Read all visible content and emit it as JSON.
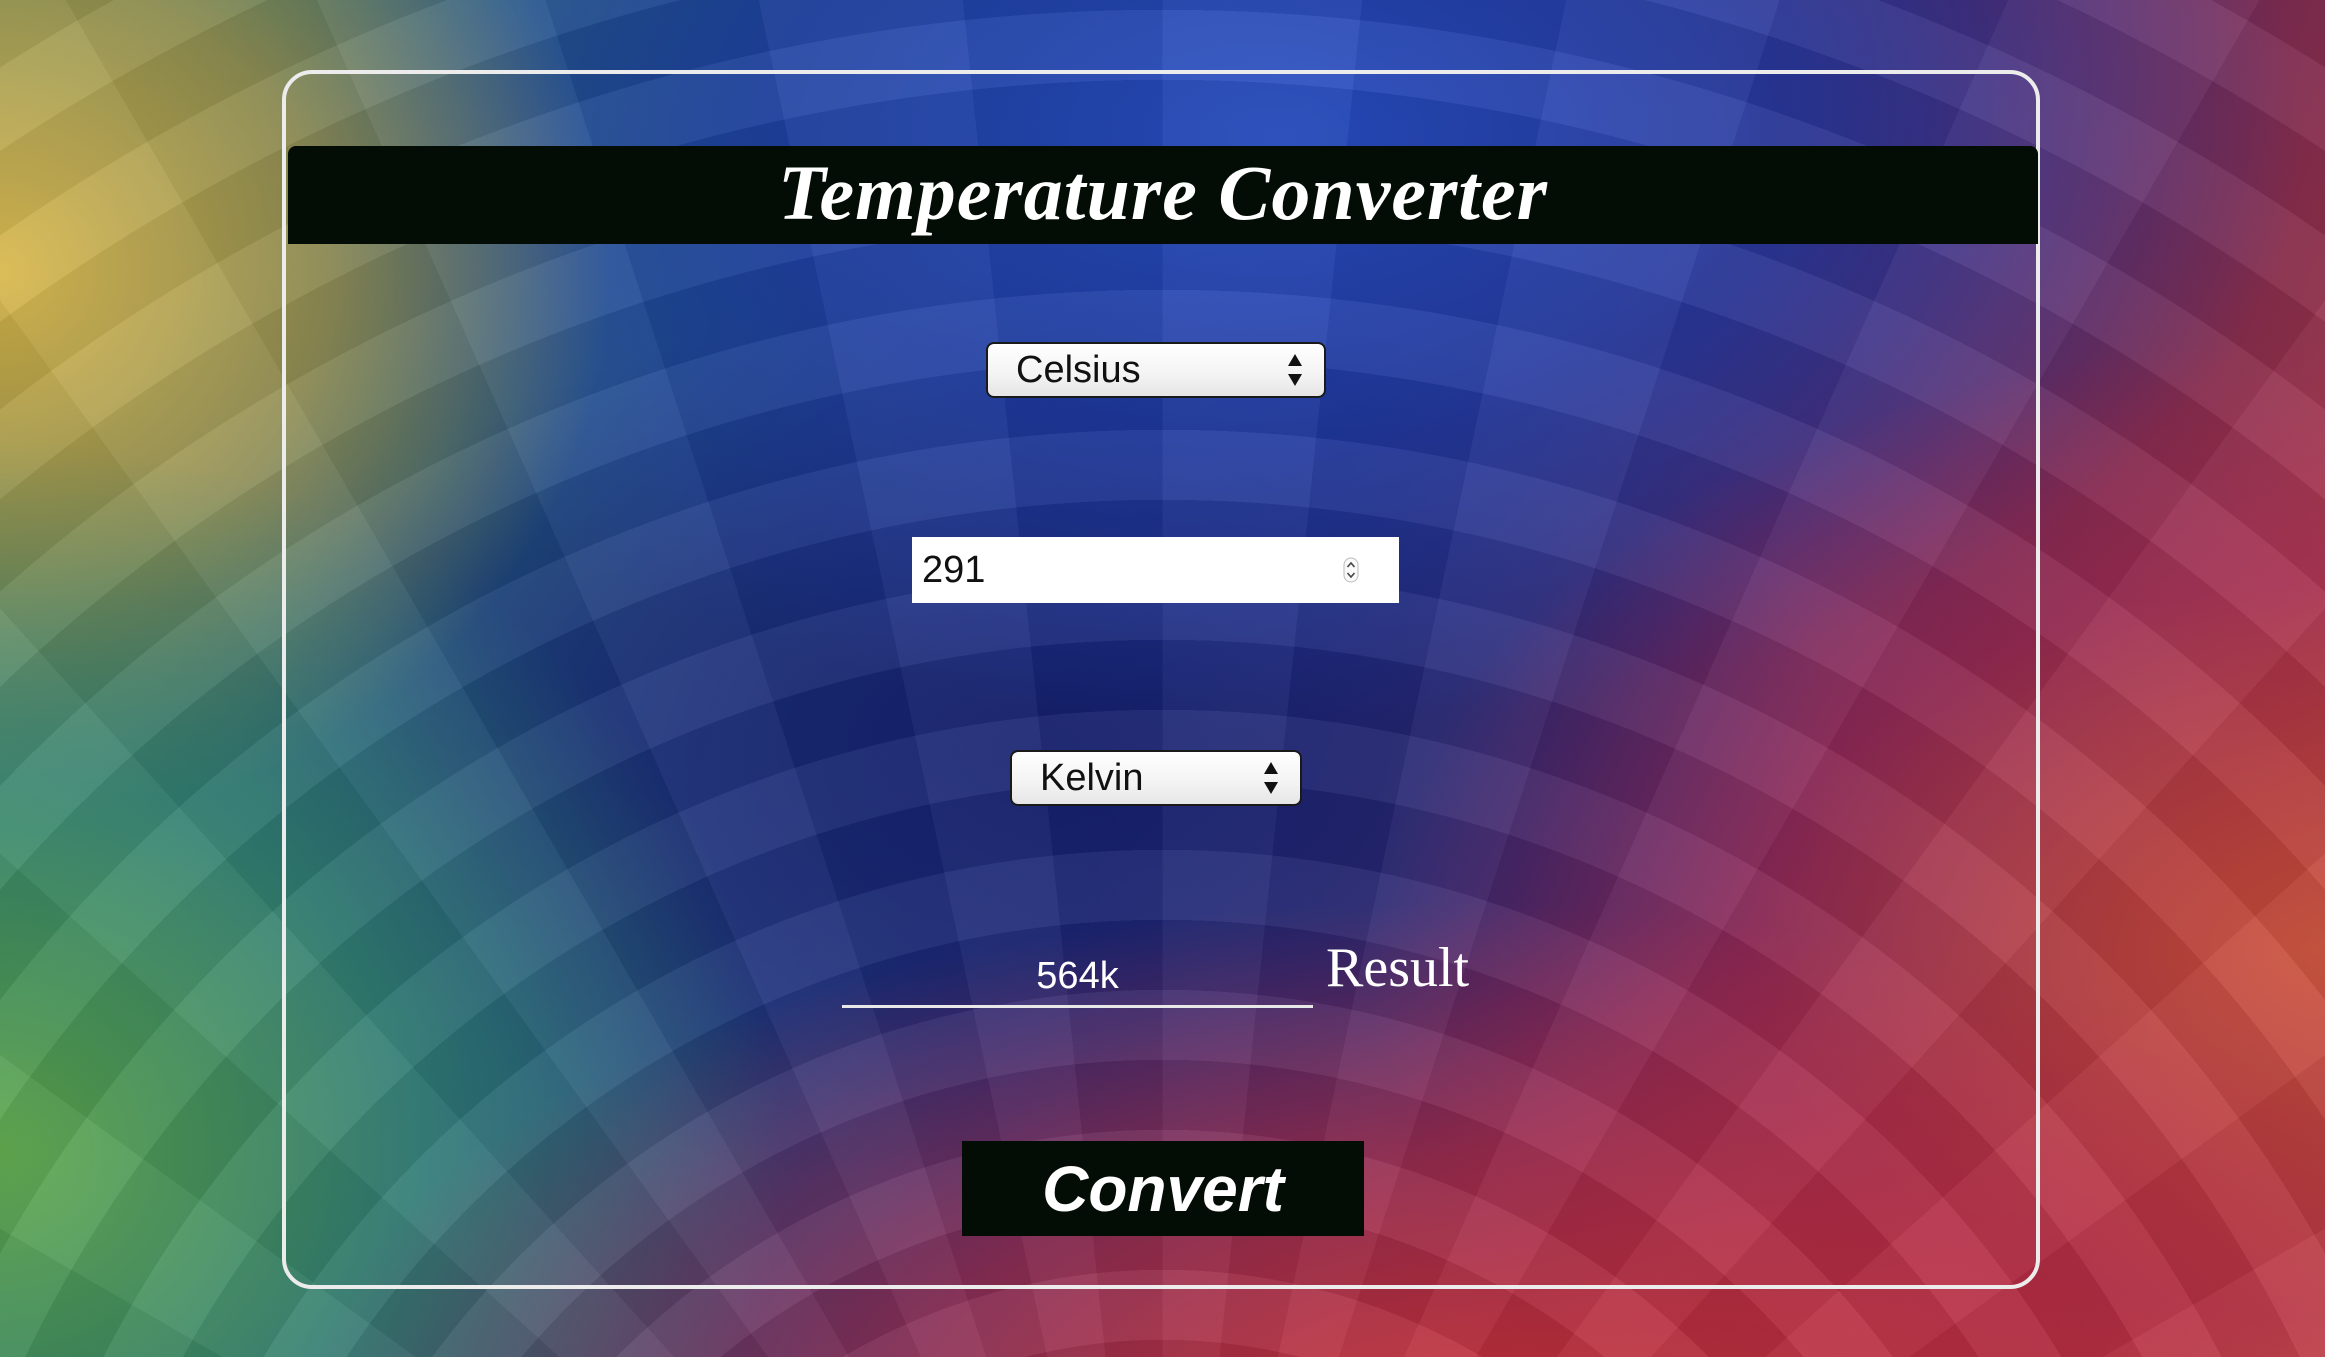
{
  "app": {
    "title": "Temperature Converter"
  },
  "form": {
    "from_unit": {
      "selected": "Celsius"
    },
    "input": {
      "value": "291"
    },
    "to_unit": {
      "selected": "Kelvin"
    },
    "result": {
      "value": "564k",
      "label": "Result"
    },
    "convert_label": "Convert"
  },
  "icons": {
    "select_arrows": "up-down-chevrons-icon",
    "spinner": "number-spinner-icon"
  },
  "colors": {
    "title_bar": "#030d06",
    "button": "#030d06",
    "card_border": "#ececec",
    "text_light": "#ffffff"
  }
}
